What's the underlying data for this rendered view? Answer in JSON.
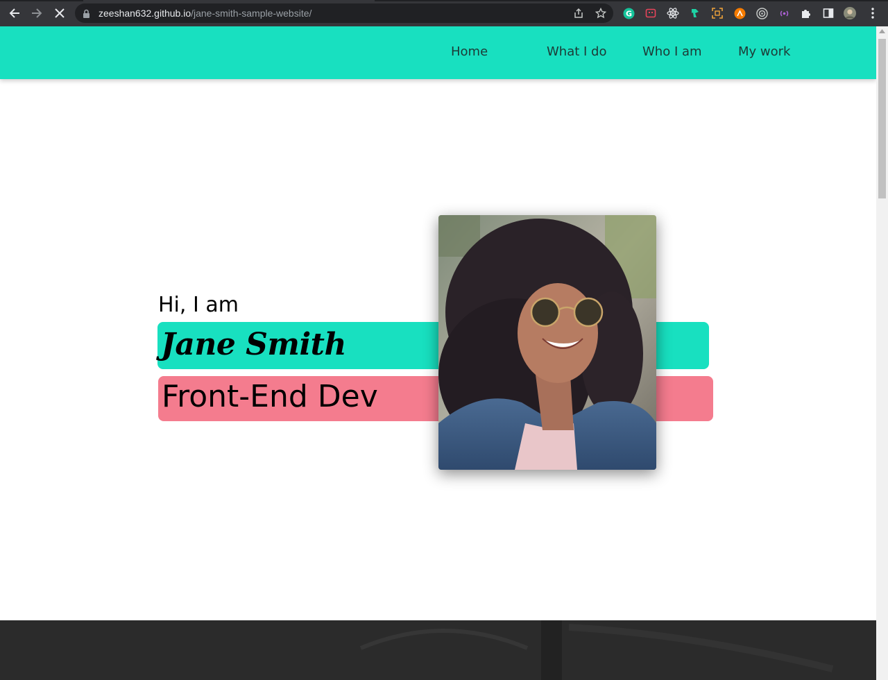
{
  "browser": {
    "url_host": "zeeshan632.github.io",
    "url_path": "/jane-smith-sample-website/",
    "icons": [
      "back-icon",
      "forward-icon",
      "stop-loading-icon",
      "lock-icon",
      "share-icon",
      "star-icon",
      "grammarly-icon",
      "extension-icon",
      "react-devtools-icon",
      "extension-icon",
      "screenshot-icon",
      "extension-icon",
      "extension-icon",
      "extension-icon",
      "puzzle-icon",
      "side-panel-icon",
      "profile-avatar",
      "menu-icon"
    ]
  },
  "nav": {
    "home": "Home",
    "what_i_do": "What I do",
    "who_i_am": "Who I am",
    "my_work": "My work"
  },
  "hero": {
    "greeting": "Hi, I am",
    "name": "Jane Smith",
    "role": "Front-End Dev"
  },
  "colors": {
    "accent": "#18e0c0",
    "role_bar": "#f47c8e",
    "dark_section": "#2b2b2b",
    "chrome": "#35363a"
  }
}
